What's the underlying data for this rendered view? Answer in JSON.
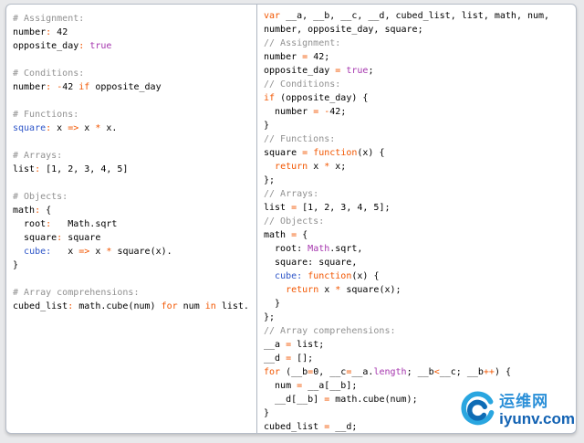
{
  "page": {
    "background": "#e8e9eb",
    "panel_background": "#ffffff",
    "panel_border": "#b6bdc8",
    "divider": "#aeb6c1"
  },
  "colors": {
    "plain": "#000000",
    "comment": "#919191",
    "keyword": "#f25600",
    "constant": "#a535ae",
    "fname": "#2d55c8"
  },
  "left_code": {
    "language": "coffeescript-source",
    "lines": [
      [
        [
          "c",
          "# Assignment:"
        ]
      ],
      [
        [
          "t",
          "number"
        ],
        [
          "k",
          ":"
        ],
        [
          "t",
          " 42"
        ]
      ],
      [
        [
          "t",
          "opposite_day"
        ],
        [
          "k",
          ":"
        ],
        [
          "t",
          " "
        ],
        [
          "p",
          "true"
        ]
      ],
      [],
      [
        [
          "c",
          "# Conditions:"
        ]
      ],
      [
        [
          "t",
          "number"
        ],
        [
          "k",
          ":"
        ],
        [
          "t",
          " "
        ],
        [
          "k",
          "-"
        ],
        [
          "t",
          "42 "
        ],
        [
          "k",
          "if"
        ],
        [
          "t",
          " opposite_day"
        ]
      ],
      [],
      [
        [
          "c",
          "# Functions:"
        ]
      ],
      [
        [
          "f",
          "square"
        ],
        [
          "k",
          ":"
        ],
        [
          "t",
          " x "
        ],
        [
          "k",
          "=>"
        ],
        [
          "t",
          " x "
        ],
        [
          "k",
          "*"
        ],
        [
          "t",
          " x."
        ]
      ],
      [],
      [
        [
          "c",
          "# Arrays:"
        ]
      ],
      [
        [
          "t",
          "list"
        ],
        [
          "k",
          ":"
        ],
        [
          "t",
          " [1, 2, 3, 4, 5]"
        ]
      ],
      [],
      [
        [
          "c",
          "# Objects:"
        ]
      ],
      [
        [
          "t",
          "math"
        ],
        [
          "k",
          ":"
        ],
        [
          "t",
          " {"
        ]
      ],
      [
        [
          "t",
          "  root"
        ],
        [
          "k",
          ":"
        ],
        [
          "t",
          "   Math.sqrt"
        ]
      ],
      [
        [
          "t",
          "  square"
        ],
        [
          "k",
          ":"
        ],
        [
          "t",
          " square"
        ]
      ],
      [
        [
          "t",
          "  "
        ],
        [
          "f",
          "cube"
        ],
        [
          "f",
          ":"
        ],
        [
          "t",
          "   x "
        ],
        [
          "k",
          "=>"
        ],
        [
          "t",
          " x "
        ],
        [
          "k",
          "*"
        ],
        [
          "t",
          " square(x)."
        ]
      ],
      [
        [
          "t",
          "}"
        ]
      ],
      [],
      [
        [
          "c",
          "# Array comprehensions:"
        ]
      ],
      [
        [
          "t",
          "cubed_list"
        ],
        [
          "k",
          ":"
        ],
        [
          "t",
          " math.cube(num) "
        ],
        [
          "k",
          "for"
        ],
        [
          "t",
          " num "
        ],
        [
          "k",
          "in"
        ],
        [
          "t",
          " list."
        ]
      ]
    ]
  },
  "right_code": {
    "language": "javascript-output",
    "lines": [
      [
        [
          "k",
          "var"
        ],
        [
          "t",
          " __a, __b, __c, __d, cubed_list, list, math, num,"
        ]
      ],
      [
        [
          "t",
          "number, opposite_day, square;"
        ]
      ],
      [
        [
          "c",
          "// Assignment:"
        ]
      ],
      [
        [
          "t",
          "number "
        ],
        [
          "k",
          "="
        ],
        [
          "t",
          " 42;"
        ]
      ],
      [
        [
          "t",
          "opposite_day "
        ],
        [
          "k",
          "="
        ],
        [
          "t",
          " "
        ],
        [
          "p",
          "true"
        ],
        [
          "t",
          ";"
        ]
      ],
      [
        [
          "c",
          "// Conditions:"
        ]
      ],
      [
        [
          "k",
          "if"
        ],
        [
          "t",
          " (opposite_day) {"
        ]
      ],
      [
        [
          "t",
          "  number "
        ],
        [
          "k",
          "="
        ],
        [
          "t",
          " "
        ],
        [
          "k",
          "-"
        ],
        [
          "t",
          "42;"
        ]
      ],
      [
        [
          "t",
          "}"
        ]
      ],
      [
        [
          "c",
          "// Functions:"
        ]
      ],
      [
        [
          "t",
          "square "
        ],
        [
          "k",
          "="
        ],
        [
          "t",
          " "
        ],
        [
          "k",
          "function"
        ],
        [
          "t",
          "(x) {"
        ]
      ],
      [
        [
          "t",
          "  "
        ],
        [
          "k",
          "return"
        ],
        [
          "t",
          " x "
        ],
        [
          "k",
          "*"
        ],
        [
          "t",
          " x;"
        ]
      ],
      [
        [
          "t",
          "};"
        ]
      ],
      [
        [
          "c",
          "// Arrays:"
        ]
      ],
      [
        [
          "t",
          "list "
        ],
        [
          "k",
          "="
        ],
        [
          "t",
          " [1, 2, 3, 4, 5];"
        ]
      ],
      [
        [
          "c",
          "// Objects:"
        ]
      ],
      [
        [
          "t",
          "math "
        ],
        [
          "k",
          "="
        ],
        [
          "t",
          " {"
        ]
      ],
      [
        [
          "t",
          "  root: "
        ],
        [
          "p",
          "Math"
        ],
        [
          "t",
          ".sqrt,"
        ]
      ],
      [
        [
          "t",
          "  square: square,"
        ]
      ],
      [
        [
          "t",
          "  "
        ],
        [
          "f",
          "cube:"
        ],
        [
          "t",
          " "
        ],
        [
          "k",
          "function"
        ],
        [
          "t",
          "(x) {"
        ]
      ],
      [
        [
          "t",
          "    "
        ],
        [
          "k",
          "return"
        ],
        [
          "t",
          " x "
        ],
        [
          "k",
          "*"
        ],
        [
          "t",
          " square(x);"
        ]
      ],
      [
        [
          "t",
          "  }"
        ]
      ],
      [
        [
          "t",
          "};"
        ]
      ],
      [
        [
          "c",
          "// Array comprehensions:"
        ]
      ],
      [
        [
          "t",
          "__a "
        ],
        [
          "k",
          "="
        ],
        [
          "t",
          " list;"
        ]
      ],
      [
        [
          "t",
          "__d "
        ],
        [
          "k",
          "="
        ],
        [
          "t",
          " [];"
        ]
      ],
      [
        [
          "k",
          "for"
        ],
        [
          "t",
          " (__b"
        ],
        [
          "k",
          "="
        ],
        [
          "t",
          "0, __c"
        ],
        [
          "k",
          "="
        ],
        [
          "t",
          "__a."
        ],
        [
          "p",
          "length"
        ],
        [
          "t",
          "; __b"
        ],
        [
          "k",
          "<"
        ],
        [
          "t",
          "__c; __b"
        ],
        [
          "k",
          "++"
        ],
        [
          "t",
          ") {"
        ]
      ],
      [
        [
          "t",
          "  num "
        ],
        [
          "k",
          "="
        ],
        [
          "t",
          " __a[__b];"
        ]
      ],
      [
        [
          "t",
          "  __d[__b] "
        ],
        [
          "k",
          "="
        ],
        [
          "t",
          " math.cube(num);"
        ]
      ],
      [
        [
          "t",
          "}"
        ]
      ],
      [
        [
          "t",
          "cubed_list "
        ],
        [
          "k",
          "="
        ],
        [
          "t",
          " __d;"
        ]
      ]
    ]
  },
  "watermark": {
    "site_name": "运维网",
    "domain": "iyunv.com",
    "logo": "swirl-logo",
    "site_color": "#2a8fd8",
    "domain_color": "#1262b3"
  }
}
